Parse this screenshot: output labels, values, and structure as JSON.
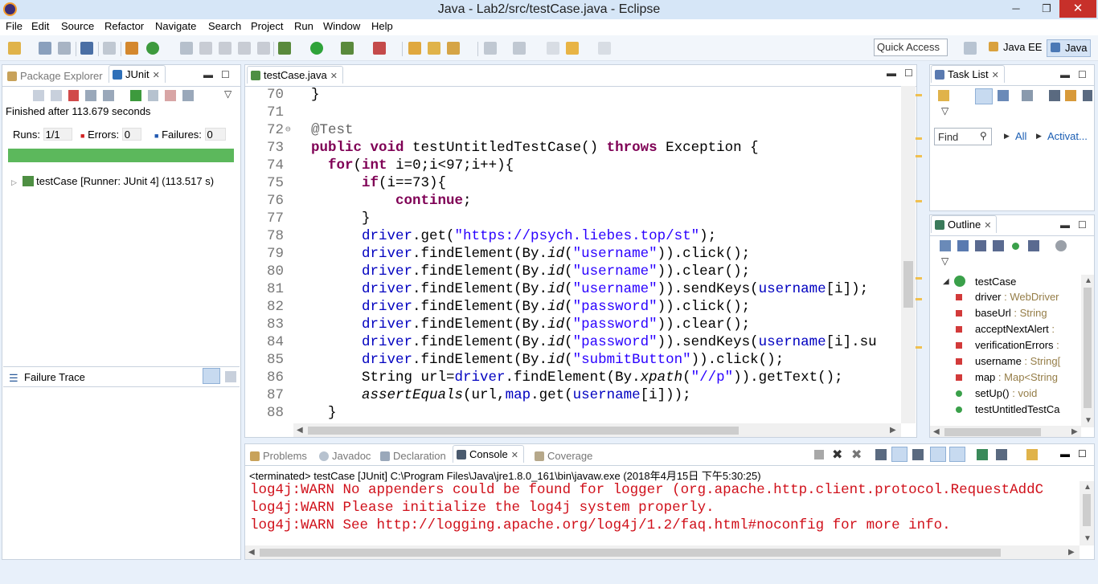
{
  "window": {
    "title": "Java - Lab2/src/testCase.java - Eclipse",
    "min_label": "─",
    "max_label": "❐",
    "close_label": "✕"
  },
  "menu": [
    "File",
    "Edit",
    "Source",
    "Refactor",
    "Navigate",
    "Search",
    "Project",
    "Run",
    "Window",
    "Help"
  ],
  "quick_access": {
    "placeholder": "Quick Access"
  },
  "perspectives": {
    "java_ee": "Java EE",
    "java": "Java"
  },
  "left_panel": {
    "tabs": {
      "package_explorer": "Package Explorer",
      "junit": "JUnit"
    },
    "finished": "Finished after 113.679 seconds",
    "runs_label": "Runs:",
    "runs_value": "1/1",
    "errors_label": "Errors:",
    "errors_value": "0",
    "failures_label": "Failures:",
    "failures_value": "0",
    "progress": 1.0,
    "progress_color": "#5cb85c",
    "tree_item": "testCase [Runner: JUnit 4] (113.517 s)",
    "failure_trace": "Failure Trace"
  },
  "editor": {
    "tab": "testCase.java",
    "lines": [
      {
        "n": "70",
        "html": "}"
      },
      {
        "n": "71",
        "html": ""
      },
      {
        "n": "72",
        "html": "<span class='ann'>@Test</span>"
      },
      {
        "n": "73",
        "html": "<span class='kw'>public</span> <span class='kw'>void</span> testUntitledTestCase() <span class='kw'>throws</span> Exception {"
      },
      {
        "n": "74",
        "html": "  <span class='kw'>for</span>(<span class='kw'>int</span> i=0;i<97;i++){"
      },
      {
        "n": "75",
        "html": "      <span class='kw'>if</span>(i==73){"
      },
      {
        "n": "76",
        "html": "          <span class='kw'>continue</span>;"
      },
      {
        "n": "77",
        "html": "      }"
      },
      {
        "n": "78",
        "html": "      <span class='fld'>driver</span>.get(<span class='str'>\"https://psych.liebes.top/st\"</span>);"
      },
      {
        "n": "79",
        "html": "      <span class='fld'>driver</span>.findElement(By.<span class='it'>id</span>(<span class='str'>\"username\"</span>)).click();"
      },
      {
        "n": "80",
        "html": "      <span class='fld'>driver</span>.findElement(By.<span class='it'>id</span>(<span class='str'>\"username\"</span>)).clear();"
      },
      {
        "n": "81",
        "html": "      <span class='fld'>driver</span>.findElement(By.<span class='it'>id</span>(<span class='str'>\"username\"</span>)).sendKeys(<span class='fld'>username</span>[i]);"
      },
      {
        "n": "82",
        "html": "      <span class='fld'>driver</span>.findElement(By.<span class='it'>id</span>(<span class='str'>\"password\"</span>)).click();"
      },
      {
        "n": "83",
        "html": "      <span class='fld'>driver</span>.findElement(By.<span class='it'>id</span>(<span class='str'>\"password\"</span>)).clear();"
      },
      {
        "n": "84",
        "html": "      <span class='fld'>driver</span>.findElement(By.<span class='it'>id</span>(<span class='str'>\"password\"</span>)).sendKeys(<span class='fld'>username</span>[i].su"
      },
      {
        "n": "85",
        "html": "      <span class='fld'>driver</span>.findElement(By.<span class='it'>id</span>(<span class='str'>\"submitButton\"</span>)).click();"
      },
      {
        "n": "86",
        "html": "      String url=<span class='fld'>driver</span>.findElement(By.<span class='it'>xpath</span>(<span class='str'>\"//p\"</span>)).getText();"
      },
      {
        "n": "87",
        "html": "      <span class='it'>assertEquals</span>(url,<span class='fld'>map</span>.get(<span class='fld'>username</span>[i]));"
      },
      {
        "n": "88",
        "html": "  }"
      }
    ]
  },
  "task_list": {
    "tab": "Task List",
    "find_placeholder": "Find",
    "all": "All",
    "activate": "Activat..."
  },
  "outline": {
    "tab": "Outline",
    "root": "testCase",
    "items": [
      {
        "name": "driver",
        "type": " : WebDriver",
        "color": "#d23a3a"
      },
      {
        "name": "baseUrl",
        "type": " : String",
        "color": "#d23a3a"
      },
      {
        "name": "acceptNextAlert",
        "type": " : ",
        "color": "#d23a3a"
      },
      {
        "name": "verificationErrors",
        "type": " : ",
        "color": "#d23a3a"
      },
      {
        "name": "username",
        "type": " : String[",
        "color": "#d23a3a"
      },
      {
        "name": "map",
        "type": " : Map<String",
        "color": "#d23a3a"
      },
      {
        "name": "setUp()",
        "type": " : void",
        "color": "#3aa04a"
      },
      {
        "name": "testUntitledTestCa",
        "type": "",
        "color": "#3aa04a"
      }
    ]
  },
  "console": {
    "tabs": {
      "problems": "Problems",
      "javadoc": "Javadoc",
      "declaration": "Declaration",
      "console": "Console",
      "coverage": "Coverage"
    },
    "header": "<terminated> testCase [JUnit] C:\\Program Files\\Java\\jre1.8.0_161\\bin\\javaw.exe (2018年4月15日 下午5:30:25)",
    "lines": [
      "log4j:WARN No appenders could be found for logger (org.apache.http.client.protocol.RequestAddC",
      "log4j:WARN Please initialize the log4j system properly.",
      "log4j:WARN See http://logging.apache.org/log4j/1.2/faq.html#noconfig for more info."
    ]
  }
}
